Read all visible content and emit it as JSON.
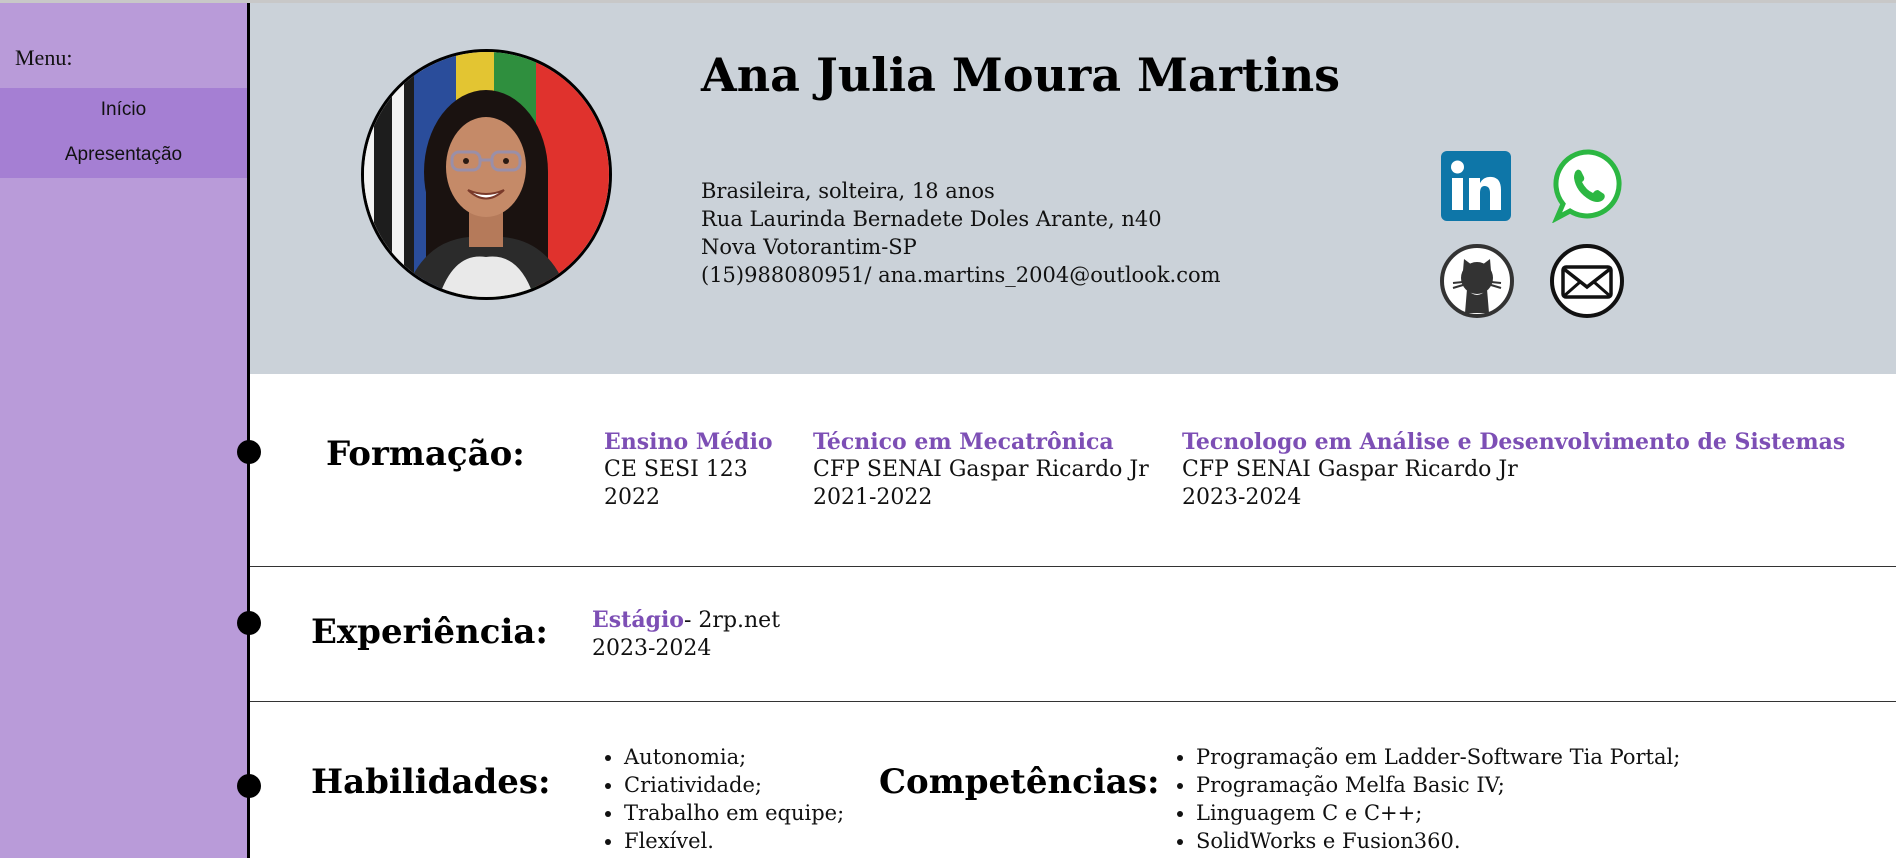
{
  "sidebar": {
    "menu_title": "Menu:",
    "items": [
      {
        "label": "Início"
      },
      {
        "label": "Apresentação"
      }
    ]
  },
  "profile": {
    "name": "Ana Julia Moura Martins",
    "info": [
      "Brasileira, solteira, 18 anos",
      "Rua Laurinda Bernadete Doles Arante, n40",
      "Nova Votorantim-SP",
      "(15)988080951/ ana.martins_2004@outlook.com"
    ],
    "social": [
      {
        "icon": "linkedin-icon",
        "color": "#0e76a8"
      },
      {
        "icon": "whatsapp-icon",
        "color": "#2cb742"
      },
      {
        "icon": "github-icon",
        "color": "#444444"
      },
      {
        "icon": "mail-icon",
        "color": "#111111"
      }
    ]
  },
  "formacao": {
    "title": "Formação:",
    "items": [
      {
        "title": "Ensino Médio",
        "place": "CE SESI 123",
        "years": "2022"
      },
      {
        "title": "Técnico em Mecatrônica",
        "place": "CFP SENAI Gaspar Ricardo Jr",
        "years": "2021-2022"
      },
      {
        "title": "Tecnologo em Análise e Desenvolvimento de Sistemas",
        "place": "CFP SENAI Gaspar Ricardo Jr",
        "years": "2023-2024"
      }
    ]
  },
  "experiencia": {
    "title": "Experiência:",
    "role": "Estágio",
    "company": "- 2rp.net",
    "years": "2023-2024"
  },
  "habilidades": {
    "title": "Habilidades:",
    "items": [
      "Autonomia;",
      "Criatividade;",
      "Trabalho em equipe;",
      "Flexível."
    ]
  },
  "competencias": {
    "title": "Competências:",
    "items": [
      "Programação em Ladder-Software Tia Portal;",
      "Programação Melfa Basic IV;",
      "Linguagem C e C++;",
      "SolidWorks e Fusion360."
    ]
  },
  "colors": {
    "sidebar": "#b99bd9",
    "menu_highlight": "#a57fd3",
    "header_bg": "#cbd2d9",
    "accent_purple": "#7d4fb5"
  }
}
